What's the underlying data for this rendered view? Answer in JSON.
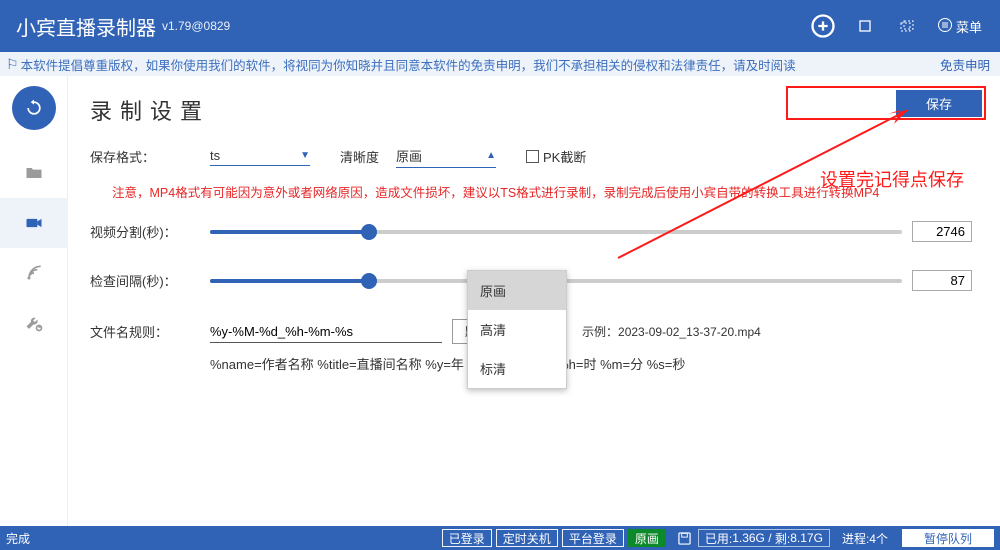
{
  "titlebar": {
    "title": "小宾直播录制器",
    "version": "v1.79@0829",
    "menu_label": "菜单"
  },
  "banner": {
    "text": "本软件提倡尊重版权，如果你使用我们的软件，将视同为你知晓并且同意本软件的免责申明，我们不承担相关的侵权和法律责任，请及时阅读",
    "disclaimer_link": "免责申明"
  },
  "sidebar": {
    "back_tooltip": "返回"
  },
  "page": {
    "title": "录制设置",
    "save_btn": "保存",
    "annotation": "设置完记得点保存"
  },
  "settings": {
    "format_label": "保存格式：",
    "format_value": "ts",
    "quality_label": "清晰度",
    "quality_value": "原画",
    "pk_cutoff_label": "PK截断",
    "warn_text": "注意，MP4格式有可能因为意外或者网络原因，造成文件损坏，建议以TS格式进行录制，录制完成后使用小宾自带的转换工具进行转换MP4",
    "split_label": "视频分割(秒)：",
    "split_value": "2746",
    "split_fill_pct": 23,
    "check_label": "检查间隔(秒)：",
    "check_value": "87",
    "check_fill_pct": 23,
    "filename_label": "文件名规则：",
    "filename_value": "%y-%M-%d_%h-%m-%s",
    "default_btn": "默认",
    "example_label": "示例：",
    "example_value": "2023-09-02_13-37-20.mp4",
    "legend": "%name=作者名称 %title=直播间名称 %y=年 %M=月 %d=日 %h=时 %m=分 %s=秒"
  },
  "quality_options": [
    "原画",
    "高清",
    "标清"
  ],
  "statusbar": {
    "left": "完成",
    "logged_in": "已登录",
    "shutdown": "定时关机",
    "platform_login": "平台登录",
    "quality_chip": "原画",
    "usage_used_label": "已用:",
    "usage_used": "1.36G",
    "usage_left_label": "剩:",
    "usage_left": "8.17G",
    "processes_label": "进程:",
    "processes": "4个",
    "pause_queue": "暂停队列"
  }
}
